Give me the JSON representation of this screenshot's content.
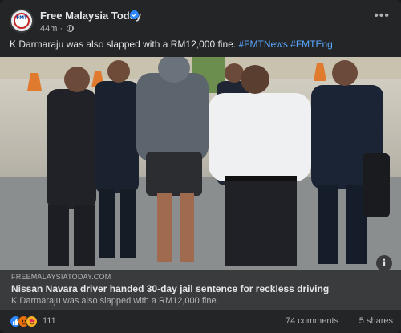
{
  "post": {
    "page_name": "Free Malaysia Today",
    "time": "44m",
    "caption_text": "K Darmaraju was also slapped with a RM12,000 fine.",
    "hashtags": [
      "#FMTNews",
      "#FMTEng"
    ],
    "avatar_letters": "FMT"
  },
  "link_preview": {
    "domain": "FREEMALAYSIATODAY.COM",
    "title": "Nissan Navara driver handed 30-day jail sentence for reckless driving",
    "subtitle": "K Darmaraju was also slapped with a RM12,000 fine.",
    "info_glyph": "i"
  },
  "footer": {
    "reaction_count": "111",
    "comments": "74 comments",
    "shares": "5 shares"
  },
  "icons": {
    "verified": "verified-badge-icon",
    "globe": "globe-icon",
    "more": "more-options-icon",
    "reactions": [
      "like-icon",
      "angry-icon",
      "love-icon"
    ]
  },
  "colors": {
    "background": "#242526",
    "link_bar": "#3a3b3c",
    "hashtag": "#5aa7ff",
    "verified": "#2d88ff"
  }
}
